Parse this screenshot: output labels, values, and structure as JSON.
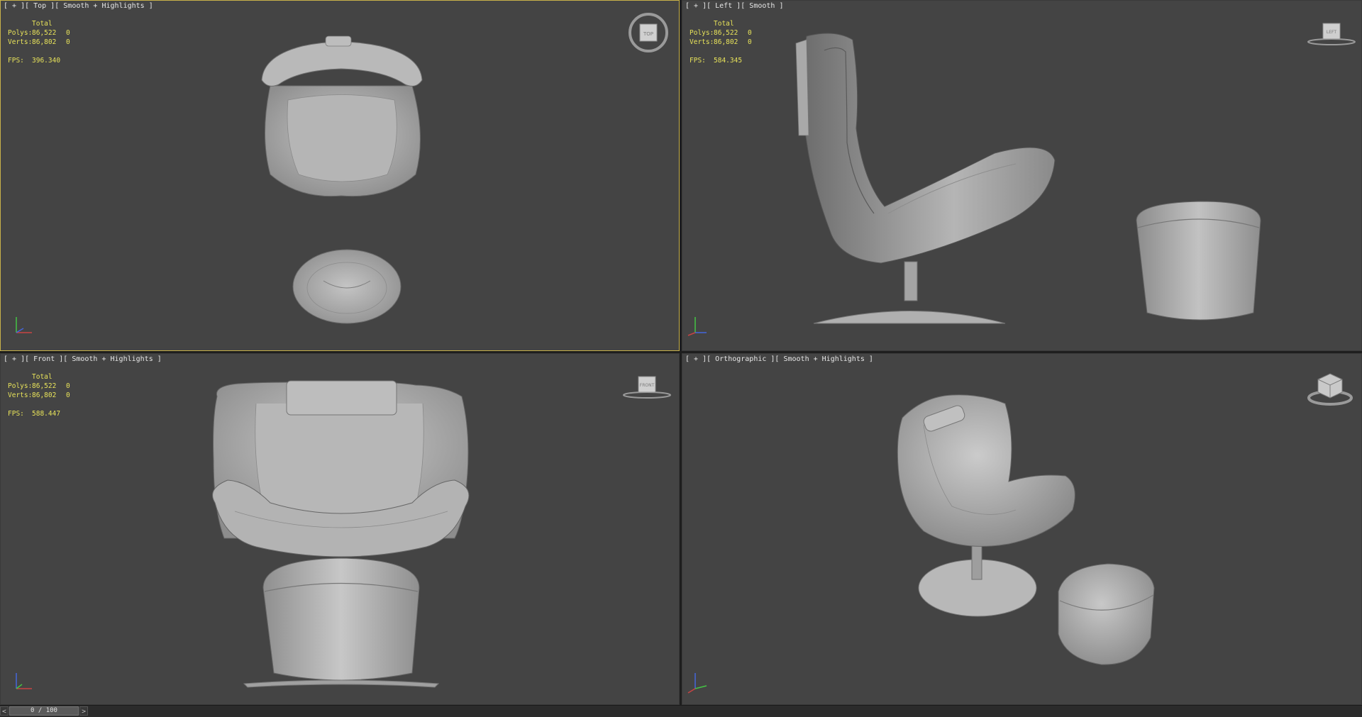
{
  "viewports": {
    "top": {
      "label": "[ + ][ Top ][ Smooth + Highlights ]",
      "stats": {
        "total": "Total",
        "polys_label": "Polys:",
        "polys": "86,522",
        "polys_sel": "0",
        "verts_label": "Verts:",
        "verts": "86,802",
        "verts_sel": "0",
        "fps_label": "FPS:",
        "fps": "396.340"
      },
      "active": true,
      "navcube": "TOP"
    },
    "left": {
      "label": "[ + ][ Left ][ Smooth ]",
      "stats": {
        "total": "Total",
        "polys_label": "Polys:",
        "polys": "86,522",
        "polys_sel": "0",
        "verts_label": "Verts:",
        "verts": "86,802",
        "verts_sel": "0",
        "fps_label": "FPS:",
        "fps": "584.345"
      },
      "navcube": "LEFT"
    },
    "front": {
      "label": "[ + ][ Front ][ Smooth + Highlights ]",
      "stats": {
        "total": "Total",
        "polys_label": "Polys:",
        "polys": "86,522",
        "polys_sel": "0",
        "verts_label": "Verts:",
        "verts": "86,802",
        "verts_sel": "0",
        "fps_label": "FPS:",
        "fps": "588.447"
      },
      "navcube": "FRONT"
    },
    "ortho": {
      "label": "[ + ][ Orthographic ][ Smooth + Highlights ]"
    }
  },
  "timeline": {
    "frame": "0 / 100",
    "prev": "<",
    "next": ">"
  },
  "colors": {
    "viewport_bg": "#444444",
    "stats_text": "#e8e35a",
    "active_border": "#c8b14a",
    "model": "#a8a8a8"
  }
}
